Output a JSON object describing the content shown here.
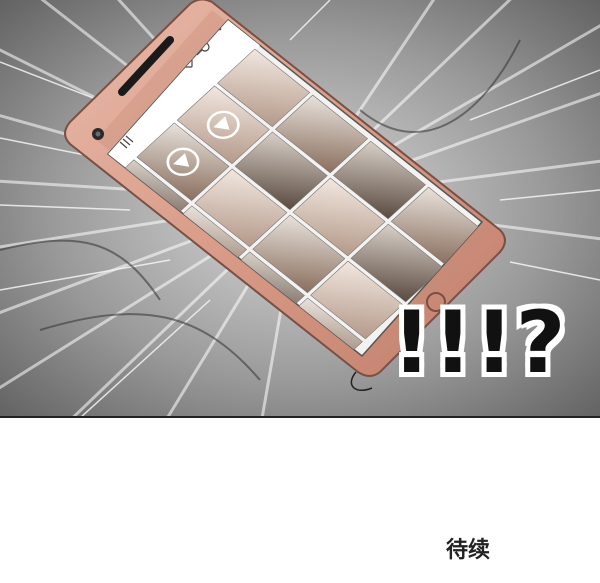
{
  "comic_panel": {
    "exclamation": "!!!?",
    "phone": {
      "thumbnail_count": 18
    }
  },
  "footer": {
    "to_be_continued": "待续"
  }
}
